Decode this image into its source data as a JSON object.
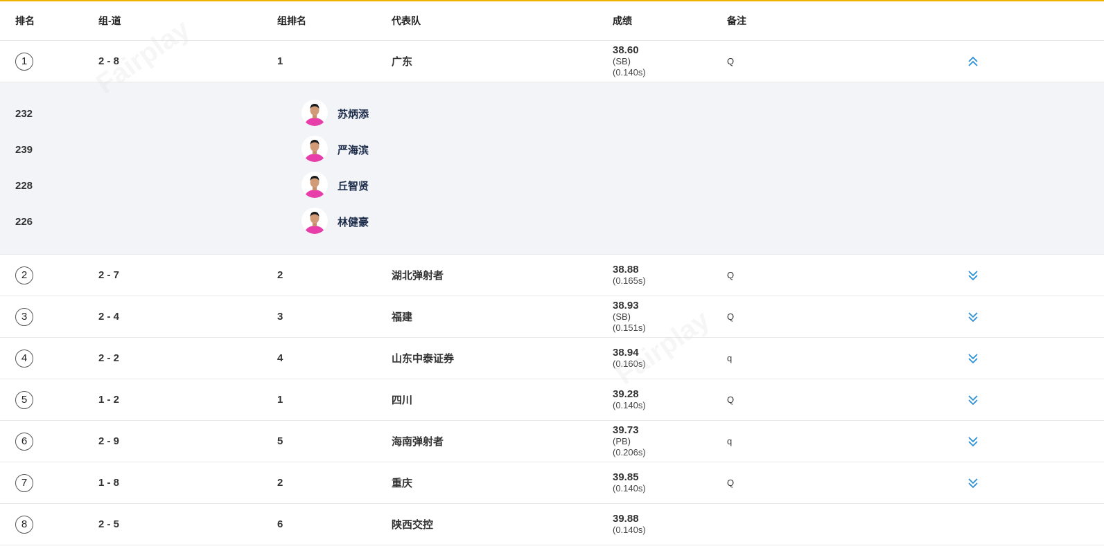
{
  "headers": {
    "rank": "排名",
    "group_lane": "组-道",
    "group_rank": "组排名",
    "team": "代表队",
    "result": "成绩",
    "note": "备注"
  },
  "rows": [
    {
      "rank": "1",
      "lane": "2 - 8",
      "group_rank": "1",
      "team": "广东",
      "mark": "38.60",
      "tags": [
        "(SB)",
        "(0.140s)"
      ],
      "note": "Q",
      "expanded": true
    },
    {
      "rank": "2",
      "lane": "2 - 7",
      "group_rank": "2",
      "team": "湖北弹射者",
      "mark": "38.88",
      "tags": [
        "(0.165s)"
      ],
      "note": "Q",
      "expanded": false
    },
    {
      "rank": "3",
      "lane": "2 - 4",
      "group_rank": "3",
      "team": "福建",
      "mark": "38.93",
      "tags": [
        "(SB)",
        "(0.151s)"
      ],
      "note": "Q",
      "expanded": false
    },
    {
      "rank": "4",
      "lane": "2 - 2",
      "group_rank": "4",
      "team": "山东中泰证券",
      "mark": "38.94",
      "tags": [
        "(0.160s)"
      ],
      "note": "q",
      "expanded": false
    },
    {
      "rank": "5",
      "lane": "1 - 2",
      "group_rank": "1",
      "team": "四川",
      "mark": "39.28",
      "tags": [
        "(0.140s)"
      ],
      "note": "Q",
      "expanded": false
    },
    {
      "rank": "6",
      "lane": "2 - 9",
      "group_rank": "5",
      "team": "海南弹射者",
      "mark": "39.73",
      "tags": [
        "(PB)",
        "(0.206s)"
      ],
      "note": "q",
      "expanded": false
    },
    {
      "rank": "7",
      "lane": "1 - 8",
      "group_rank": "2",
      "team": "重庆",
      "mark": "39.85",
      "tags": [
        "(0.140s)"
      ],
      "note": "Q",
      "expanded": false
    },
    {
      "rank": "8",
      "lane": "2 - 5",
      "group_rank": "6",
      "team": "陕西交控",
      "mark": "39.88",
      "tags": [
        "(0.140s)"
      ],
      "note": "",
      "expanded": false
    }
  ],
  "athletes": [
    {
      "bib": "232",
      "name": "苏炳添"
    },
    {
      "bib": "239",
      "name": "严海滨"
    },
    {
      "bib": "228",
      "name": "丘智贤"
    },
    {
      "bib": "226",
      "name": "林健豪"
    }
  ],
  "icons": {
    "collapse": "chevron-double-up-icon",
    "expand": "chevron-double-down-icon",
    "avatar": "athlete-avatar"
  },
  "colors": {
    "accent_line": "#f0b400",
    "chevron": "#2a8fd6",
    "detail_bg": "#f3f4f8",
    "name": "#1b2b4a"
  }
}
